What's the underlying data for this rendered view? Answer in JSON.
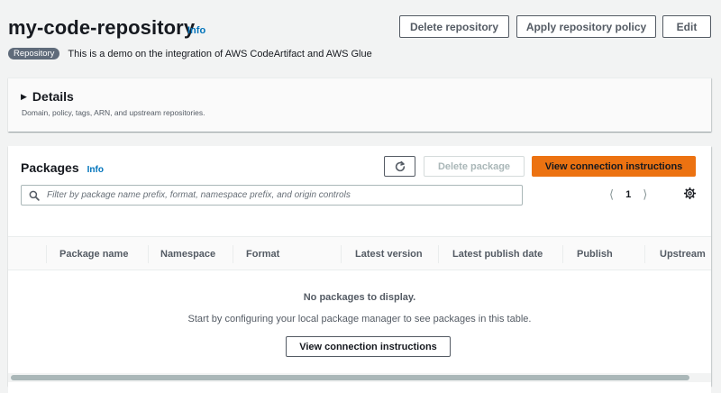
{
  "header": {
    "title": "my-code-repository",
    "info_label": "Info",
    "badge": "Repository",
    "description": "This is a demo on the integration of AWS CodeArtifact and AWS Glue",
    "buttons": {
      "delete": "Delete repository",
      "apply_policy": "Apply repository policy",
      "edit": "Edit"
    }
  },
  "details": {
    "title": "Details",
    "description": "Domain, policy, tags, ARN, and upstream repositories.",
    "expanded": false
  },
  "packages": {
    "title": "Packages",
    "info_label": "Info",
    "refresh_icon": "refresh-icon",
    "delete_label": "Delete package",
    "connect_label": "View connection instructions",
    "search_placeholder": "Filter by package name prefix, format, namespace prefix, and origin controls",
    "search_value": "",
    "page_number": "1",
    "columns": [
      "Package name",
      "Namespace",
      "Format",
      "Latest version",
      "Latest publish date",
      "Publish",
      "Upstream"
    ],
    "empty_title": "No packages to display.",
    "empty_description": "Start by configuring your local package manager to see packages in this table.",
    "empty_button": "View connection instructions"
  },
  "colors": {
    "primary": "#ec7211",
    "link": "#0073bb",
    "badge": "#5f6b7a",
    "background": "#f2f3f3"
  }
}
